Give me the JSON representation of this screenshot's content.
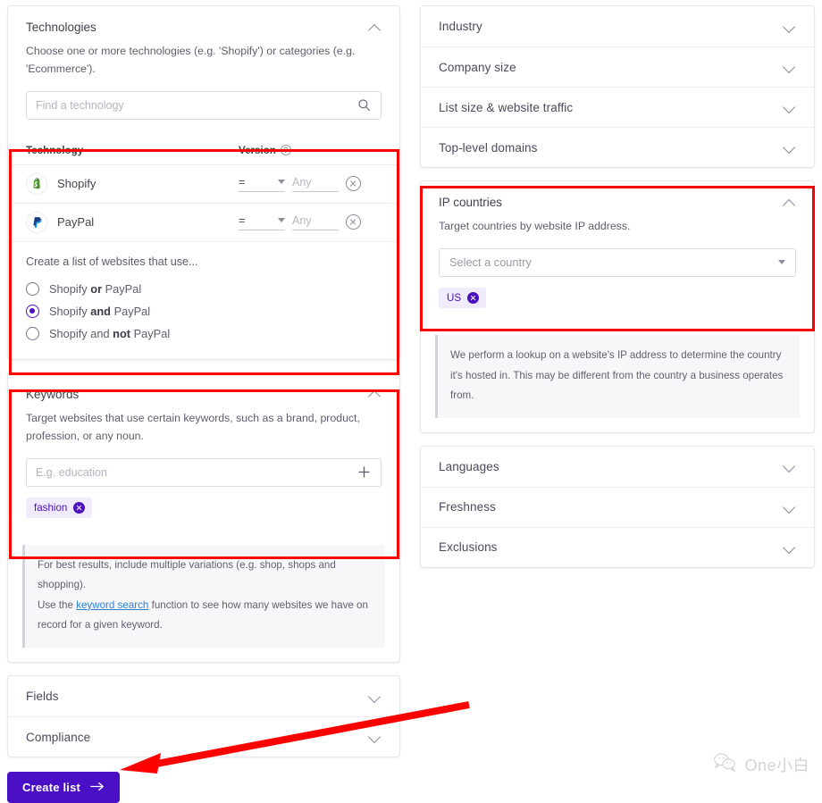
{
  "left_column": {
    "technologies": {
      "title": "Technologies",
      "collapse_icon": "chevron-up-icon",
      "description": "Choose one or more technologies (e.g. 'Shopify') or categories (e.g. 'Ecommerce').",
      "search": {
        "placeholder": "Find a technology",
        "value": "",
        "icon": "search-icon"
      },
      "table": {
        "headers": {
          "technology": "Technology",
          "version": "Version",
          "version_help_icon": "question-circle-icon"
        },
        "rows": [
          {
            "name": "Shopify",
            "logo": "shopify-logo-icon",
            "operator": "=",
            "version_placeholder": "Any",
            "version_value": "",
            "remove_icon": "remove-circle-icon"
          },
          {
            "name": "PayPal",
            "logo": "paypal-logo-icon",
            "operator": "=",
            "version_placeholder": "Any",
            "version_value": "",
            "remove_icon": "remove-circle-icon"
          }
        ]
      },
      "logic": {
        "intro": "Create a list of websites that use...",
        "options": [
          {
            "prefix": "Shopify ",
            "strong": "or",
            "suffix": " PayPal",
            "selected": false
          },
          {
            "prefix": "Shopify ",
            "strong": "and",
            "suffix": " PayPal",
            "selected": true
          },
          {
            "prefix": "Shopify and ",
            "strong": "not",
            "suffix": " PayPal",
            "selected": false
          }
        ]
      }
    },
    "keywords": {
      "title": "Keywords",
      "collapse_icon": "chevron-up-icon",
      "description": "Target websites that use certain keywords, such as a brand, product, profession, or any noun.",
      "input": {
        "placeholder": "E.g. education",
        "value": "",
        "add_icon": "plus-icon"
      },
      "chips": [
        {
          "label": "fashion",
          "remove_icon": "chip-remove-icon"
        }
      ],
      "note": {
        "line1": "For best results, include multiple variations (e.g. shop, shops and shopping).",
        "line2_before": "Use the ",
        "line2_link": "keyword search",
        "line2_after": " function to see how many websites we have on record for a given keyword."
      }
    },
    "collapsed_sections": [
      {
        "label": "Fields",
        "icon": "chevron-down-icon"
      },
      {
        "label": "Compliance",
        "icon": "chevron-down-icon"
      }
    ],
    "submit": {
      "label": "Create list",
      "arrow_icon": "arrow-right-icon"
    }
  },
  "right_column": {
    "top_sections": [
      {
        "label": "Industry",
        "icon": "chevron-down-icon"
      },
      {
        "label": "Company size",
        "icon": "chevron-down-icon"
      },
      {
        "label": "List size & website traffic",
        "icon": "chevron-down-icon"
      },
      {
        "label": "Top-level domains",
        "icon": "chevron-down-icon"
      }
    ],
    "ip_countries": {
      "title": "IP countries",
      "collapse_icon": "chevron-up-icon",
      "description": "Target countries by website IP address.",
      "select": {
        "placeholder": "Select a country",
        "value": "",
        "icon": "caret-down-icon"
      },
      "chips": [
        {
          "label": "US",
          "remove_icon": "chip-remove-icon"
        }
      ],
      "note": "We perform a lookup on a website's IP address to determine the country it's hosted in. This may be different from the country a business operates from."
    },
    "bottom_sections": [
      {
        "label": "Languages",
        "icon": "chevron-down-icon"
      },
      {
        "label": "Freshness",
        "icon": "chevron-down-icon"
      },
      {
        "label": "Exclusions",
        "icon": "chevron-down-icon"
      }
    ]
  },
  "watermark": {
    "text": "One小白",
    "icon": "wechat-icon"
  },
  "annotations": {
    "highlight_color": "#ff0000",
    "arrow_color": "#ff0000",
    "boxes": [
      {
        "name": "technologies-table-highlight"
      },
      {
        "name": "keywords-highlight"
      },
      {
        "name": "ip-countries-highlight"
      }
    ]
  },
  "colors": {
    "accent_purple": "#4c0fc0",
    "button_purple": "#4a0fc4",
    "chip_bg": "#f0ecfd",
    "link_blue": "#2f7fd0"
  }
}
